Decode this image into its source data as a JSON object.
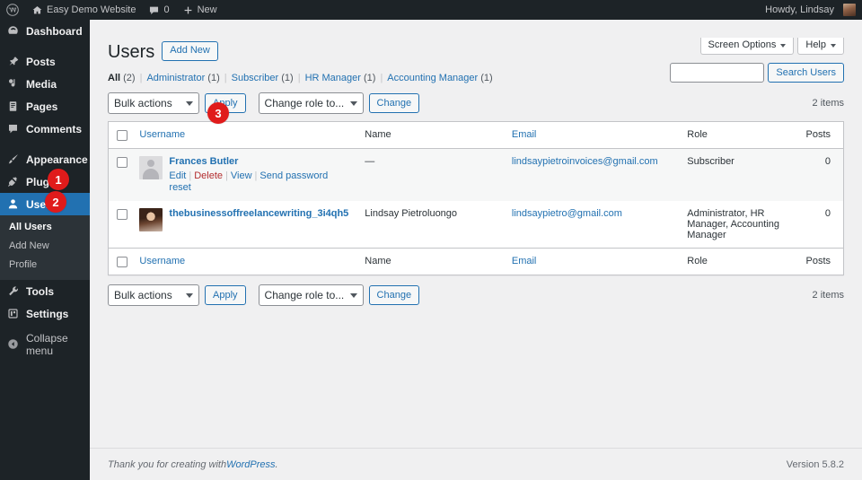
{
  "adminbar": {
    "logo_icon": "wordpress-logo-icon",
    "site_name": "Easy Demo Website",
    "site_icon": "home-icon",
    "comments_icon": "comment-bubble-icon",
    "comments_count": "0",
    "new_icon": "plus-icon",
    "new_label": "New",
    "howdy": "Howdy, Lindsay",
    "avatar_icon": "user-avatar"
  },
  "sidebar": {
    "items": [
      {
        "label": "Dashboard",
        "icon": "dashboard-icon"
      },
      {
        "label": "Posts",
        "icon": "pin-icon"
      },
      {
        "label": "Media",
        "icon": "media-icon"
      },
      {
        "label": "Pages",
        "icon": "page-icon"
      },
      {
        "label": "Comments",
        "icon": "comment-icon"
      },
      {
        "label": "Appearance",
        "icon": "paintbrush-icon"
      },
      {
        "label": "Plugins",
        "icon": "plug-icon"
      },
      {
        "label": "Users",
        "icon": "users-icon"
      },
      {
        "label": "Tools",
        "icon": "wrench-icon"
      },
      {
        "label": "Settings",
        "icon": "settings-icon"
      },
      {
        "label": "Collapse menu",
        "icon": "collapse-arrow-icon"
      }
    ],
    "submenu": [
      {
        "label": "All Users",
        "current": true
      },
      {
        "label": "Add New",
        "current": false
      },
      {
        "label": "Profile",
        "current": false
      }
    ]
  },
  "badges": [
    {
      "number": "1"
    },
    {
      "number": "2"
    },
    {
      "number": "3"
    }
  ],
  "screen_meta": {
    "screen_options": "Screen Options",
    "help": "Help"
  },
  "page": {
    "title": "Users",
    "add_new": "Add New",
    "items_count": "2 items"
  },
  "filters": [
    {
      "label": "All",
      "count": "(2)",
      "current": true
    },
    {
      "label": "Administrator",
      "count": "(1)",
      "current": false
    },
    {
      "label": "Subscriber",
      "count": "(1)",
      "current": false
    },
    {
      "label": "HR Manager",
      "count": "(1)",
      "current": false
    },
    {
      "label": "Accounting Manager",
      "count": "(1)",
      "current": false
    }
  ],
  "search": {
    "value": "",
    "placeholder": "",
    "button": "Search Users",
    "icon": "search-icon"
  },
  "tablenav": {
    "bulk_actions": "Bulk actions",
    "apply": "Apply",
    "change_role": "Change role to...",
    "change": "Change"
  },
  "table": {
    "columns": [
      "Username",
      "Name",
      "Email",
      "Role",
      "Posts"
    ],
    "rows": [
      {
        "username": "Frances Butler",
        "avatar": "generic-avatar",
        "name": "—",
        "email": "lindsaypietroinvoices@gmail.com",
        "role": "Subscriber",
        "posts": "0",
        "actions": [
          "Edit",
          "Delete",
          "View",
          "Send password reset"
        ]
      },
      {
        "username": "thebusinessoffreelancewriting_3i4qh5",
        "avatar": "photo-avatar",
        "name": "Lindsay Pietroluongo",
        "email": "lindsaypietro@gmail.com",
        "role": "Administrator, HR Manager, Accounting Manager",
        "posts": "0",
        "actions": []
      }
    ]
  },
  "footer": {
    "thanks_prefix": "Thank you for creating with ",
    "wordpress_link": "WordPress",
    "thanks_suffix": ".",
    "version": "Version 5.8.2"
  },
  "colors": {
    "admin_bar": "#1d2327",
    "sidebar": "#1d2327",
    "submenu": "#2c3338",
    "accent_blue": "#2271b1",
    "badge_red": "#e01b1b",
    "page_bg": "#f0f0f1",
    "delete_red": "#b32d2e"
  }
}
